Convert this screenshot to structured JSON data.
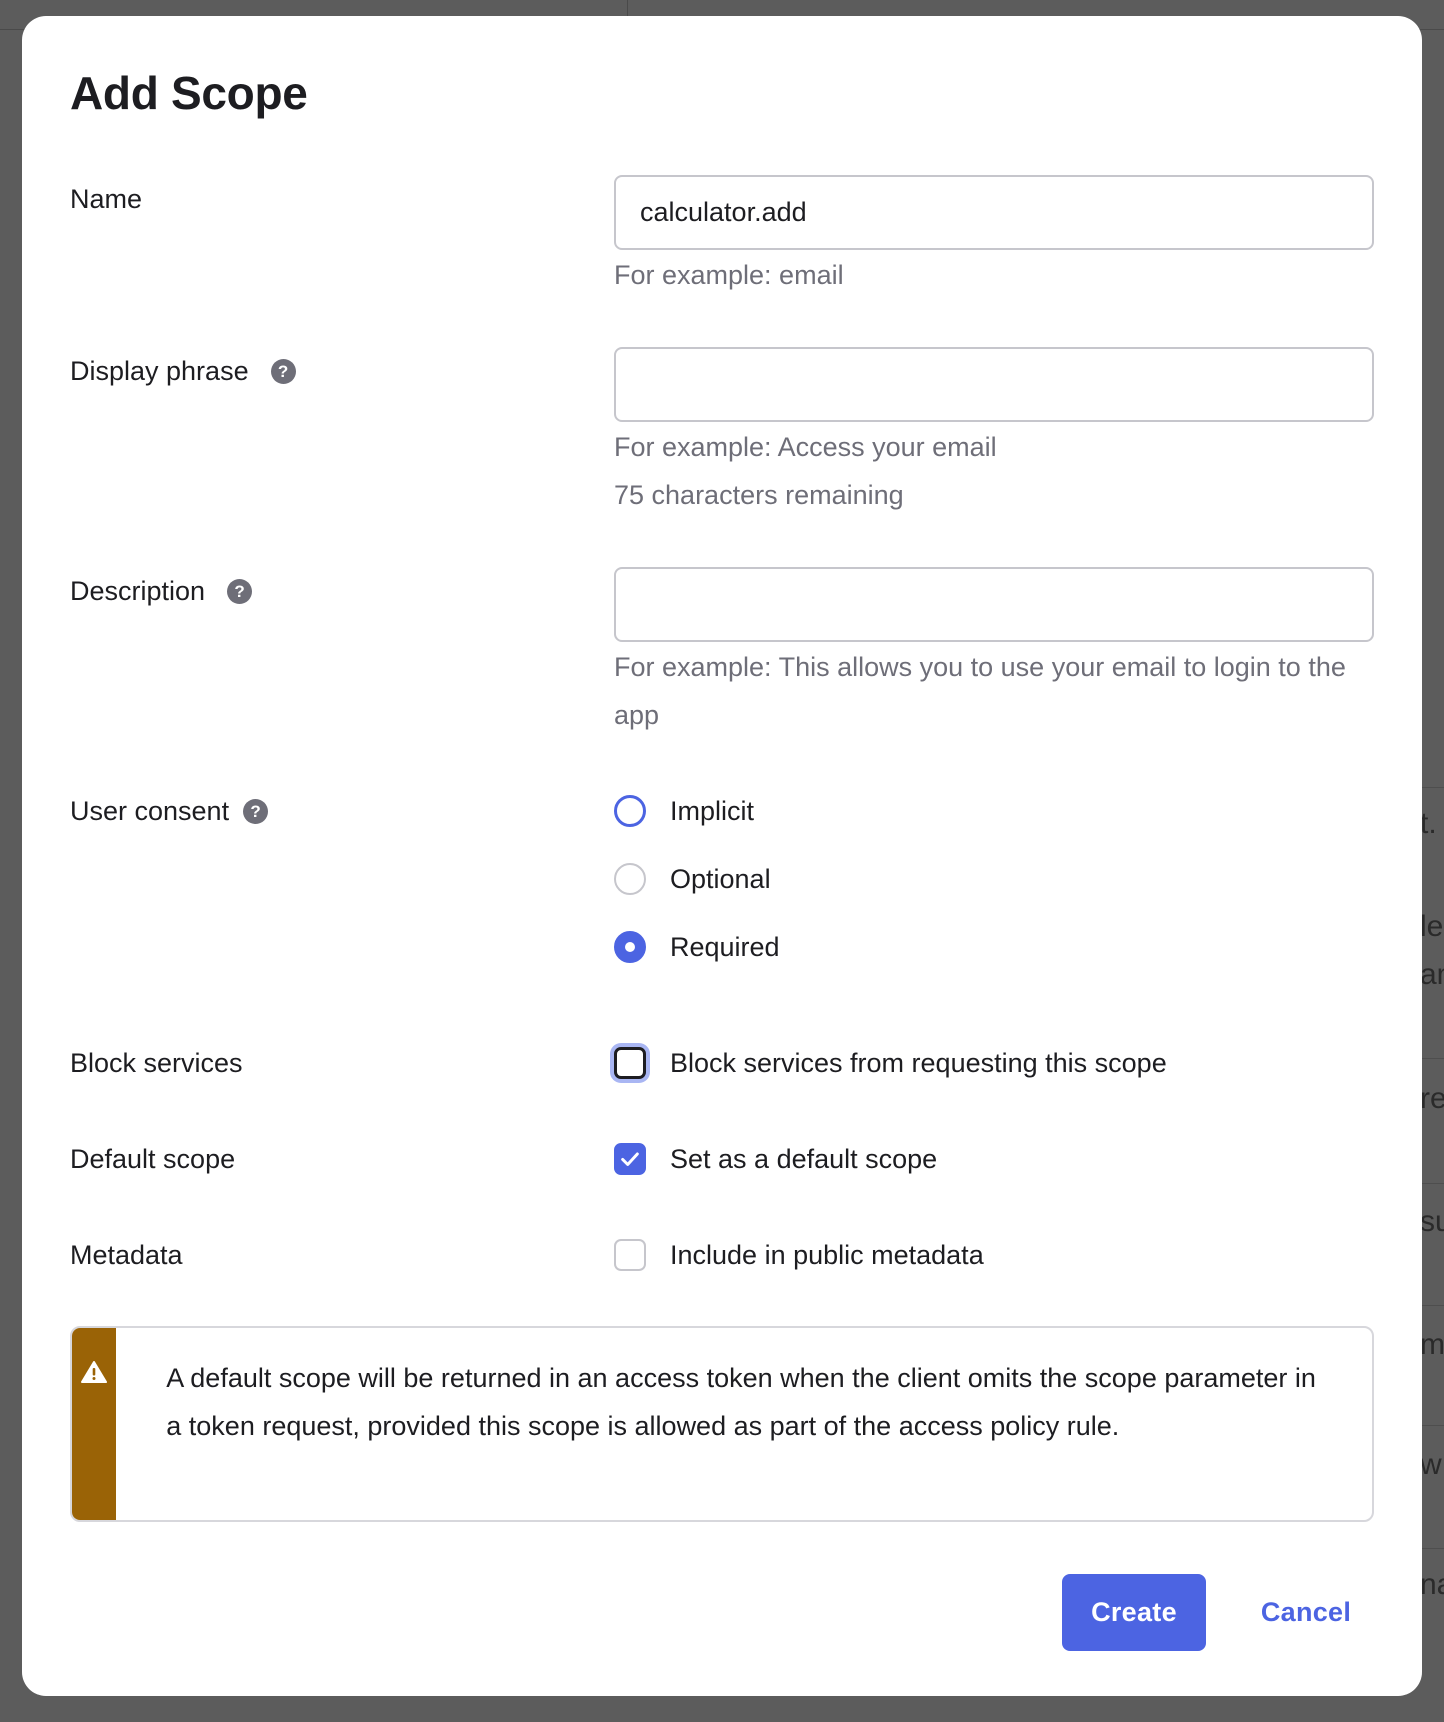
{
  "modal": {
    "title": "Add Scope",
    "fields": {
      "name": {
        "label": "Name",
        "value": "calculator.add",
        "hint": "For example: email"
      },
      "display_phrase": {
        "label": "Display phrase",
        "value": "",
        "hint": "For example: Access your email",
        "remaining": "75 characters remaining"
      },
      "description": {
        "label": "Description",
        "value": "",
        "hint": "For example: This allows you to use your email to login to the app"
      },
      "user_consent": {
        "label": "User consent",
        "options": [
          {
            "label": "Implicit",
            "checked": false
          },
          {
            "label": "Optional",
            "checked": false
          },
          {
            "label": "Required",
            "checked": true
          }
        ]
      },
      "block_services": {
        "label": "Block services",
        "option_label": "Block services from requesting this scope",
        "checked": false
      },
      "default_scope": {
        "label": "Default scope",
        "option_label": "Set as a default scope",
        "checked": true
      },
      "metadata": {
        "label": "Metadata",
        "option_label": "Include in public metadata",
        "checked": false
      }
    },
    "callout": {
      "icon": "warning-icon",
      "text": "A default scope will be returned in an access token when the client omits the scope parameter in a token request, provided this scope is allowed as part of the access policy rule."
    },
    "buttons": {
      "create": "Create",
      "cancel": "Cancel"
    }
  },
  "background_fragments": [
    "t.",
    "le",
    "am",
    "re",
    "su",
    "m",
    "w",
    "na"
  ],
  "colors": {
    "accent": "#4c64e2",
    "warning": "#9a6306",
    "overlay": "#5c5c5c"
  }
}
